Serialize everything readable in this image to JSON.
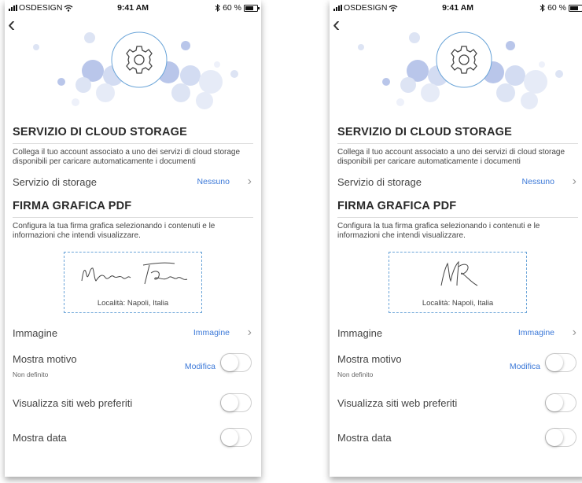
{
  "status": {
    "carrier": "OSDESIGN",
    "time": "9:41 AM",
    "battery": "60 %"
  },
  "icons": {
    "back": "chevron-left-icon",
    "settings": "gear-icon",
    "chevron": "chevron-right-icon",
    "wifi": "wifi-icon",
    "bluetooth": "bluetooth-icon"
  },
  "colors": {
    "accent": "#3b78d8",
    "circle_light": "#dde4f4",
    "circle_dark": "#b9c6ea",
    "dashed_border": "#6aa4d8"
  },
  "screens": [
    {
      "cloud": {
        "title": "SERVIZIO DI CLOUD STORAGE",
        "description": "Collega il tuo account associato a uno dei servizi di cloud storage disponibili per caricare automaticamente i documenti",
        "storage_label": "Servizio di storage",
        "storage_value": "Nessuno"
      },
      "signature": {
        "title": "FIRMA GRAFICA PDF",
        "description": "Configura la tua firma grafica selezionando i contenuti e le informazioni che intendi visualizzare.",
        "location": "Località: Napoli, Italia",
        "style": "full-name"
      },
      "image": {
        "label": "Immagine",
        "value": "Immagine"
      },
      "pattern": {
        "label": "Mostra motivo",
        "sublabel": "Non definito",
        "action": "Modifica",
        "on": false
      },
      "websites": {
        "label": "Visualizza siti web preferiti",
        "on": false
      },
      "date": {
        "label": "Mostra data",
        "on": false
      }
    },
    {
      "cloud": {
        "title": "SERVIZIO DI CLOUD STORAGE",
        "description": "Collega il tuo account associato a uno dei servizi di cloud storage disponibili per caricare automaticamente i documenti",
        "storage_label": "Servizio di storage",
        "storage_value": "Nessuno"
      },
      "signature": {
        "title": "FIRMA GRAFICA PDF",
        "description": "Configura la tua firma grafica selezionando i contenuti e le informazioni che intendi visualizzare.",
        "location": "Località: Napoli, Italia",
        "style": "initials"
      },
      "image": {
        "label": "Immagine",
        "value": "Immagine"
      },
      "pattern": {
        "label": "Mostra motivo",
        "sublabel": "Non definito",
        "action": "Modifica",
        "on": false
      },
      "websites": {
        "label": "Visualizza siti web preferiti",
        "on": false
      },
      "date": {
        "label": "Mostra data",
        "on": false
      }
    }
  ]
}
